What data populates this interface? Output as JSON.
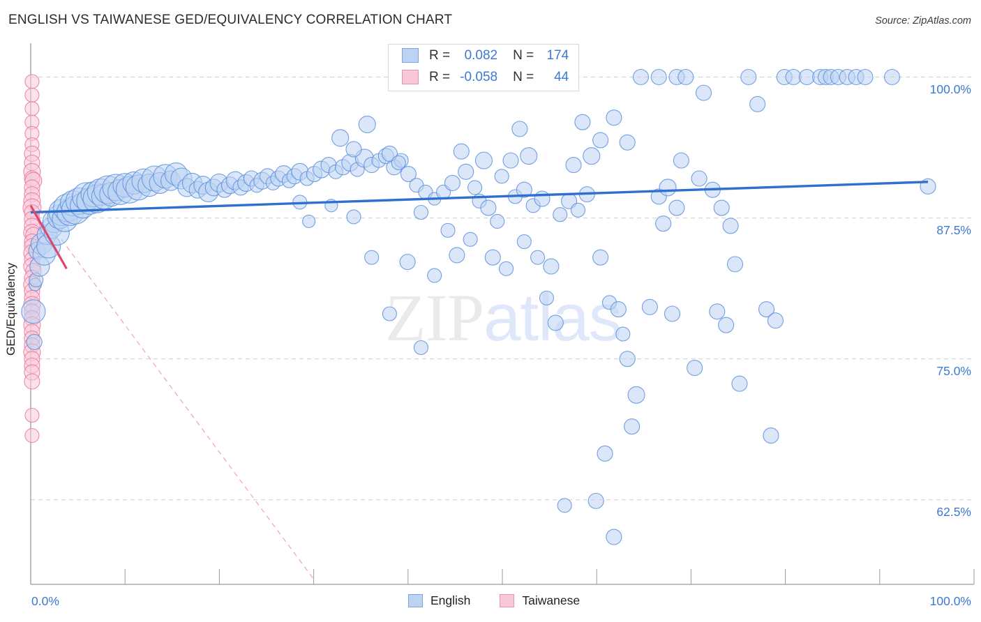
{
  "title": "ENGLISH VS TAIWANESE GED/EQUIVALENCY CORRELATION CHART",
  "source": "Source: ZipAtlas.com",
  "watermark": {
    "part1": "ZIP",
    "part2": "atlas"
  },
  "axis_title_y": "GED/Equivalency",
  "legend_box": {
    "rows": [
      {
        "series": "English",
        "r_label": "R =",
        "r_value": "0.082",
        "n_label": "N =",
        "n_value": "174",
        "color": "#bdd3f2"
      },
      {
        "series": "Taiwanese",
        "r_label": "R =",
        "r_value": "-0.058",
        "n_label": "N =",
        "n_value": "44",
        "color": "#f9c8d8"
      }
    ]
  },
  "bottom_legend": [
    {
      "label": "English",
      "color": "#bdd3f2"
    },
    {
      "label": "Taiwanese",
      "color": "#f9c8d8"
    }
  ],
  "colors": {
    "blue_fill": "#bdd3f2",
    "blue_stroke": "#5b90dd",
    "pink_fill": "#f9c8d8",
    "pink_stroke": "#e8789f",
    "trend_blue": "#2f6fd0",
    "trend_pink": "#d9496f",
    "axis": "#9a9a9a",
    "grid": "#cfcfcf",
    "tick_text": "#3b79d4"
  },
  "chart_data": {
    "type": "scatter",
    "title": "ENGLISH VS TAIWANESE GED/EQUIVALENCY CORRELATION CHART",
    "xlabel": "",
    "ylabel": "GED/Equivalency",
    "xlim": [
      0,
      100
    ],
    "ylim": [
      55.0,
      103.0
    ],
    "grid": true,
    "legend_position": "top-center",
    "xticks": [
      {
        "value": 0,
        "label": "0.0%"
      },
      {
        "value": 100,
        "label": "100.0%"
      }
    ],
    "yticks": [
      {
        "value": 100.0,
        "label": "100.0%"
      },
      {
        "value": 87.5,
        "label": "87.5%"
      },
      {
        "value": 75.0,
        "label": "75.0%"
      },
      {
        "value": 62.5,
        "label": "62.5%"
      }
    ],
    "series": [
      {
        "name": "English",
        "r": 0.082,
        "n": 174,
        "color": "#bdd3f2",
        "trendline": {
          "x0": 0,
          "y0": 88.0,
          "x1": 100,
          "y1": 90.7,
          "style": "solid",
          "color": "#2f6fd0"
        },
        "points": [
          [
            0.3,
            79.2,
            17
          ],
          [
            0.4,
            76.5,
            11
          ],
          [
            0.5,
            81.6,
            9
          ],
          [
            0.6,
            82.0,
            10
          ],
          [
            0.7,
            84.6,
            12
          ],
          [
            1.0,
            83.2,
            14
          ],
          [
            1.2,
            85.2,
            15
          ],
          [
            1.5,
            84.3,
            16
          ],
          [
            1.8,
            86.0,
            14
          ],
          [
            2.0,
            85.0,
            17
          ],
          [
            2.3,
            86.6,
            15
          ],
          [
            2.6,
            87.2,
            16
          ],
          [
            2.9,
            86.2,
            18
          ],
          [
            3.2,
            87.6,
            17
          ],
          [
            3.5,
            88.0,
            19
          ],
          [
            3.8,
            87.4,
            18
          ],
          [
            4.1,
            88.4,
            20
          ],
          [
            4.4,
            88.0,
            19
          ],
          [
            4.7,
            88.8,
            18
          ],
          [
            5.0,
            88.2,
            20
          ],
          [
            5.4,
            89.0,
            19
          ],
          [
            5.8,
            88.6,
            18
          ],
          [
            6.2,
            89.4,
            20
          ],
          [
            6.6,
            89.0,
            19
          ],
          [
            7.0,
            89.6,
            18
          ],
          [
            7.4,
            89.2,
            20
          ],
          [
            7.8,
            89.8,
            19
          ],
          [
            8.2,
            89.4,
            18
          ],
          [
            8.6,
            90.0,
            20
          ],
          [
            9.0,
            89.6,
            17
          ],
          [
            9.5,
            90.2,
            19
          ],
          [
            10.0,
            89.8,
            18
          ],
          [
            10.5,
            90.4,
            17
          ],
          [
            11.0,
            90.0,
            19
          ],
          [
            11.5,
            90.6,
            16
          ],
          [
            12.0,
            90.2,
            18
          ],
          [
            12.6,
            90.8,
            17
          ],
          [
            13.2,
            90.4,
            16
          ],
          [
            13.8,
            91.0,
            18
          ],
          [
            14.4,
            90.6,
            15
          ],
          [
            15.0,
            91.2,
            17
          ],
          [
            15.6,
            90.8,
            14
          ],
          [
            16.2,
            91.4,
            16
          ],
          [
            16.8,
            91.0,
            15
          ],
          [
            17.4,
            90.2,
            13
          ],
          [
            18.0,
            90.6,
            14
          ],
          [
            18.6,
            90.0,
            12
          ],
          [
            19.2,
            90.4,
            13
          ],
          [
            19.8,
            89.8,
            14
          ],
          [
            20.4,
            90.2,
            12
          ],
          [
            21.0,
            90.6,
            13
          ],
          [
            21.6,
            90.0,
            11
          ],
          [
            22.2,
            90.4,
            12
          ],
          [
            22.8,
            90.8,
            13
          ],
          [
            23.4,
            90.2,
            11
          ],
          [
            24.0,
            90.6,
            12
          ],
          [
            24.6,
            91.0,
            11
          ],
          [
            25.2,
            90.4,
            10
          ],
          [
            25.8,
            90.8,
            12
          ],
          [
            26.4,
            91.2,
            11
          ],
          [
            27.0,
            90.6,
            10
          ],
          [
            27.6,
            91.0,
            11
          ],
          [
            28.2,
            91.4,
            12
          ],
          [
            28.8,
            90.8,
            10
          ],
          [
            29.4,
            91.2,
            11
          ],
          [
            30.0,
            91.6,
            12
          ],
          [
            30.8,
            91.0,
            10
          ],
          [
            31.6,
            91.4,
            11
          ],
          [
            32.4,
            91.8,
            12
          ],
          [
            33.2,
            92.2,
            11
          ],
          [
            34.0,
            91.6,
            10
          ],
          [
            34.8,
            92.0,
            11
          ],
          [
            35.6,
            92.4,
            12
          ],
          [
            36.4,
            91.8,
            10
          ],
          [
            37.2,
            92.8,
            13
          ],
          [
            38.0,
            92.2,
            11
          ],
          [
            34.5,
            94.6,
            12
          ],
          [
            36.0,
            93.6,
            11
          ],
          [
            38.8,
            92.6,
            10
          ],
          [
            39.6,
            93.0,
            11
          ],
          [
            30.0,
            88.9,
            10
          ],
          [
            33.5,
            88.6,
            9
          ],
          [
            36.0,
            87.6,
            10
          ],
          [
            31.0,
            87.2,
            9
          ],
          [
            40.5,
            92.0,
            11
          ],
          [
            41.3,
            92.6,
            10
          ],
          [
            42.1,
            91.4,
            11
          ],
          [
            43.0,
            90.4,
            10
          ],
          [
            44.0,
            89.8,
            10
          ],
          [
            37.5,
            95.8,
            12
          ],
          [
            40.0,
            93.2,
            11
          ],
          [
            41.0,
            92.4,
            10
          ],
          [
            43.5,
            88.0,
            10
          ],
          [
            45.0,
            89.2,
            9
          ],
          [
            46.0,
            89.8,
            10
          ],
          [
            47.0,
            90.6,
            11
          ],
          [
            38.0,
            84.0,
            10
          ],
          [
            42.0,
            83.6,
            11
          ],
          [
            45.0,
            82.4,
            10
          ],
          [
            47.5,
            84.2,
            11
          ],
          [
            40.0,
            79.0,
            10
          ],
          [
            43.5,
            76.0,
            10
          ],
          [
            48.5,
            91.6,
            11
          ],
          [
            49.5,
            90.2,
            10
          ],
          [
            50.0,
            89.0,
            10
          ],
          [
            51.0,
            88.4,
            11
          ],
          [
            52.0,
            87.2,
            10
          ],
          [
            48.0,
            93.4,
            11
          ],
          [
            50.5,
            92.6,
            12
          ],
          [
            52.5,
            91.2,
            10
          ],
          [
            46.5,
            86.4,
            10
          ],
          [
            49.0,
            85.6,
            10
          ],
          [
            51.5,
            84.0,
            11
          ],
          [
            53.0,
            83.0,
            10
          ],
          [
            54.0,
            89.4,
            10
          ],
          [
            55.0,
            90.0,
            11
          ],
          [
            56.0,
            88.6,
            10
          ],
          [
            57.0,
            89.2,
            11
          ],
          [
            53.5,
            92.6,
            11
          ],
          [
            55.5,
            93.0,
            12
          ],
          [
            54.5,
            95.4,
            11
          ],
          [
            55.0,
            85.4,
            10
          ],
          [
            56.5,
            84.0,
            10
          ],
          [
            58.0,
            83.2,
            11
          ],
          [
            57.5,
            80.4,
            10
          ],
          [
            58.5,
            78.2,
            11
          ],
          [
            59.0,
            87.8,
            10
          ],
          [
            60.0,
            89.0,
            11
          ],
          [
            61.0,
            88.2,
            10
          ],
          [
            62.0,
            89.6,
            11
          ],
          [
            60.5,
            92.2,
            11
          ],
          [
            62.5,
            93.0,
            12
          ],
          [
            61.5,
            96.0,
            11
          ],
          [
            59.5,
            62.0,
            10
          ],
          [
            63.0,
            62.4,
            11
          ],
          [
            65.0,
            59.2,
            11
          ],
          [
            63.5,
            84.0,
            11
          ],
          [
            64.5,
            80.0,
            10
          ],
          [
            65.5,
            79.4,
            11
          ],
          [
            66.0,
            77.2,
            10
          ],
          [
            64.0,
            66.6,
            11
          ],
          [
            66.5,
            75.0,
            11
          ],
          [
            67.5,
            71.8,
            12
          ],
          [
            67.0,
            69.0,
            11
          ],
          [
            65.0,
            96.4,
            11
          ],
          [
            63.5,
            94.4,
            11
          ],
          [
            66.5,
            94.2,
            11
          ],
          [
            68.0,
            100.0,
            11
          ],
          [
            70.0,
            89.4,
            11
          ],
          [
            71.0,
            90.2,
            12
          ],
          [
            72.0,
            88.4,
            11
          ],
          [
            70.5,
            87.0,
            11
          ],
          [
            69.0,
            79.6,
            11
          ],
          [
            71.5,
            79.0,
            11
          ],
          [
            74.0,
            74.2,
            11
          ],
          [
            72.5,
            92.6,
            11
          ],
          [
            74.5,
            91.0,
            11
          ],
          [
            76.0,
            90.0,
            11
          ],
          [
            70.0,
            100.0,
            11
          ],
          [
            72.0,
            100.0,
            11
          ],
          [
            73.0,
            100.0,
            11
          ],
          [
            75.0,
            98.6,
            11
          ],
          [
            77.0,
            88.4,
            11
          ],
          [
            78.0,
            86.8,
            11
          ],
          [
            76.5,
            79.2,
            11
          ],
          [
            77.5,
            78.0,
            11
          ],
          [
            79.0,
            72.8,
            11
          ],
          [
            78.5,
            83.4,
            11
          ],
          [
            80.0,
            100.0,
            11
          ],
          [
            81.0,
            97.6,
            11
          ],
          [
            82.0,
            79.4,
            11
          ],
          [
            83.0,
            78.4,
            11
          ],
          [
            82.5,
            68.2,
            11
          ],
          [
            84.0,
            100.0,
            11
          ],
          [
            85.0,
            100.0,
            11
          ],
          [
            86.5,
            100.0,
            11
          ],
          [
            88.0,
            100.0,
            11
          ],
          [
            88.6,
            100.0,
            11
          ],
          [
            89.2,
            100.0,
            11
          ],
          [
            90.0,
            100.0,
            11
          ],
          [
            91.0,
            100.0,
            11
          ],
          [
            92.0,
            100.0,
            11
          ],
          [
            93.0,
            100.0,
            11
          ],
          [
            96.0,
            100.0,
            11
          ],
          [
            100.0,
            90.3,
            11
          ]
        ]
      },
      {
        "name": "Taiwanese",
        "r": -0.058,
        "n": 44,
        "color": "#f9c8d8",
        "trendline": {
          "x0": 0,
          "y0": 88.6,
          "x1": 4.0,
          "y1": 83.0,
          "style": "solid",
          "color": "#d9496f"
        },
        "trendline_extension": {
          "x0": 1.0,
          "y0": 88.2,
          "x1": 31.5,
          "y1": 55.5,
          "style": "dashed",
          "color": "#f0a0b8"
        },
        "points": [
          [
            0.15,
            99.6,
            10
          ],
          [
            0.15,
            98.4,
            10
          ],
          [
            0.15,
            97.2,
            10
          ],
          [
            0.15,
            96.0,
            10
          ],
          [
            0.15,
            95.0,
            10
          ],
          [
            0.15,
            94.0,
            10
          ],
          [
            0.15,
            93.2,
            11
          ],
          [
            0.15,
            92.4,
            11
          ],
          [
            0.15,
            91.6,
            12
          ],
          [
            0.15,
            91.0,
            11
          ],
          [
            0.3,
            90.8,
            12
          ],
          [
            0.15,
            90.2,
            11
          ],
          [
            0.15,
            89.6,
            11
          ],
          [
            0.15,
            89.0,
            12
          ],
          [
            0.15,
            88.4,
            13
          ],
          [
            0.15,
            88.0,
            11
          ],
          [
            0.15,
            87.4,
            11
          ],
          [
            0.15,
            86.8,
            11
          ],
          [
            0.15,
            86.2,
            12
          ],
          [
            0.3,
            86.0,
            11
          ],
          [
            0.15,
            85.4,
            11
          ],
          [
            0.15,
            85.0,
            11
          ],
          [
            0.15,
            84.4,
            12
          ],
          [
            0.15,
            83.8,
            11
          ],
          [
            0.15,
            83.2,
            12
          ],
          [
            0.3,
            82.8,
            11
          ],
          [
            0.15,
            82.2,
            11
          ],
          [
            0.15,
            81.6,
            12
          ],
          [
            0.15,
            81.0,
            11
          ],
          [
            0.15,
            80.4,
            11
          ],
          [
            0.15,
            79.8,
            12
          ],
          [
            0.15,
            79.2,
            11
          ],
          [
            0.15,
            78.6,
            11
          ],
          [
            0.15,
            78.0,
            12
          ],
          [
            0.15,
            77.4,
            11
          ],
          [
            0.15,
            76.8,
            11
          ],
          [
            0.15,
            76.2,
            11
          ],
          [
            0.15,
            75.6,
            12
          ],
          [
            0.15,
            75.0,
            11
          ],
          [
            0.15,
            74.4,
            11
          ],
          [
            0.15,
            73.8,
            11
          ],
          [
            0.15,
            73.0,
            11
          ],
          [
            0.15,
            70.0,
            10
          ],
          [
            0.15,
            68.2,
            10
          ]
        ]
      }
    ]
  }
}
